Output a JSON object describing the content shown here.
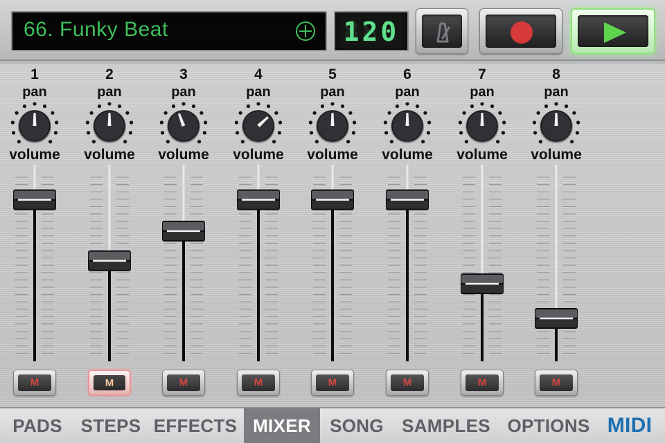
{
  "header": {
    "song_name": "66. Funky Beat",
    "bpm": "120",
    "add_icon": "circle-plus-icon",
    "metronome_icon": "metronome-icon",
    "record_icon": "record-dot-icon",
    "play_icon": "play-triangle-icon"
  },
  "labels": {
    "pan": "pan",
    "volume": "volume",
    "mute": "M"
  },
  "channels": [
    {
      "number": "1",
      "pan": 0.0,
      "volume": 0.93,
      "muted": false
    },
    {
      "number": "2",
      "pan": 0.0,
      "volume": 0.56,
      "muted": true
    },
    {
      "number": "3",
      "pan": -0.15,
      "volume": 0.74,
      "muted": false
    },
    {
      "number": "4",
      "pan": 0.35,
      "volume": 0.93,
      "muted": false
    },
    {
      "number": "5",
      "pan": 0.0,
      "volume": 0.93,
      "muted": false
    },
    {
      "number": "6",
      "pan": 0.0,
      "volume": 0.93,
      "muted": false
    },
    {
      "number": "7",
      "pan": 0.0,
      "volume": 0.42,
      "muted": false
    },
    {
      "number": "8",
      "pan": 0.0,
      "volume": 0.21,
      "muted": false
    }
  ],
  "tabs": [
    {
      "label": "PADS",
      "active": false
    },
    {
      "label": "STEPS",
      "active": false
    },
    {
      "label": "EFFECTS",
      "active": false
    },
    {
      "label": "MIXER",
      "active": true
    },
    {
      "label": "SONG",
      "active": false
    },
    {
      "label": "SAMPLES",
      "active": false
    },
    {
      "label": "OPTIONS",
      "active": false
    },
    {
      "label": "MIDI",
      "active": false
    }
  ],
  "colors": {
    "display_green": "#3fbf5a",
    "record_red": "#d63a3a",
    "play_green": "#5fd34e",
    "mute_red": "#d4473f",
    "midi_blue": "#1c6fb0",
    "active_tab": "#7a7c80"
  }
}
